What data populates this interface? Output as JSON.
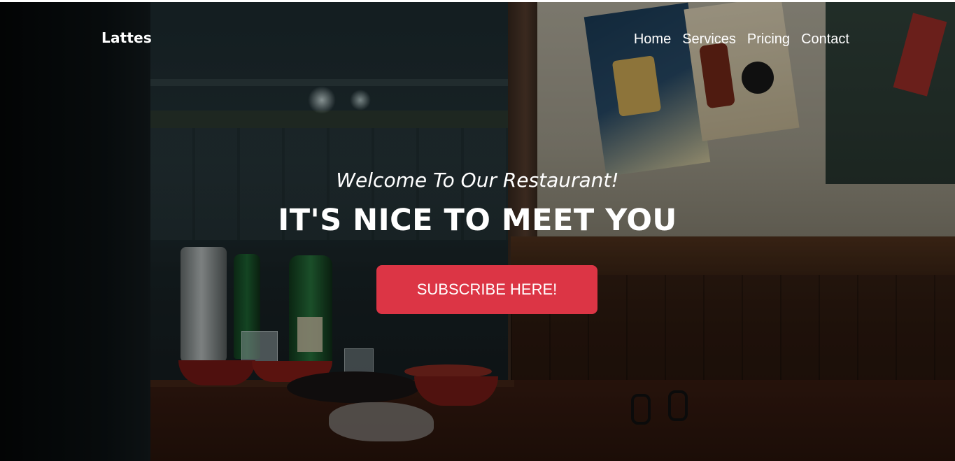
{
  "navbar": {
    "brand": "Lattes",
    "links": [
      {
        "label": "Home"
      },
      {
        "label": "Services"
      },
      {
        "label": "Pricing"
      },
      {
        "label": "Contact"
      }
    ]
  },
  "hero": {
    "subtitle": "Welcome To Our Restaurant!",
    "title": "IT'S NICE TO MEET YOU",
    "cta_label": "SUBSCRIBE HERE!",
    "background_image": "restaurant-table-at-night"
  },
  "colors": {
    "cta_background": "#dc3545",
    "text": "#ffffff"
  }
}
